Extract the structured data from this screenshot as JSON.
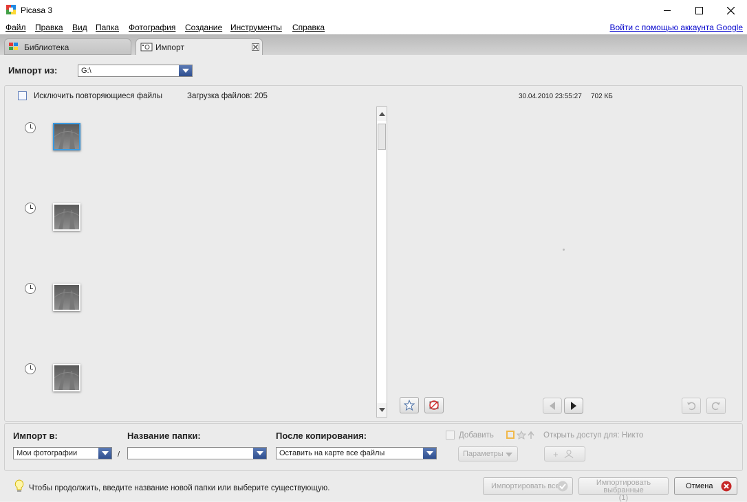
{
  "window": {
    "title": "Picasa 3"
  },
  "menu": {
    "items": [
      "Файл",
      "Правка",
      "Вид",
      "Папка",
      "Фотография",
      "Создание",
      "Инструменты",
      "Справка"
    ],
    "signin_link": "Войти с помощью аккаунта Google"
  },
  "tabs": {
    "library": "Библиотека",
    "import": "Импорт"
  },
  "import_from": {
    "label": "Импорт из:",
    "value": "G:\\"
  },
  "options": {
    "exclude_duplicates": "Исключить повторяющиеся файлы",
    "exclude_duplicates_checked": false,
    "loading_files": "Загрузка файлов: 205"
  },
  "preview_info": {
    "datetime": "30.04.2010 23:55:27",
    "size": "702 КБ"
  },
  "bottom": {
    "import_to_label": "Импорт в:",
    "import_to_value": "Мои фотографии",
    "folder_name_label": "Название папки:",
    "folder_name_value": "",
    "separator": "/",
    "after_copy_label": "После копирования:",
    "after_copy_value": "Оставить на карте все файлы",
    "add_label": "Добавить",
    "share_label": "Открыть доступ для: Никто",
    "params_label": "Параметры"
  },
  "status": {
    "hint": "Чтобы продолжить, введите название новой папки или выберите существующую.",
    "import_all": "Импортировать все",
    "import_selected": "Импортировать выбранные",
    "import_selected_count": "(1)",
    "cancel": "Отмена"
  }
}
